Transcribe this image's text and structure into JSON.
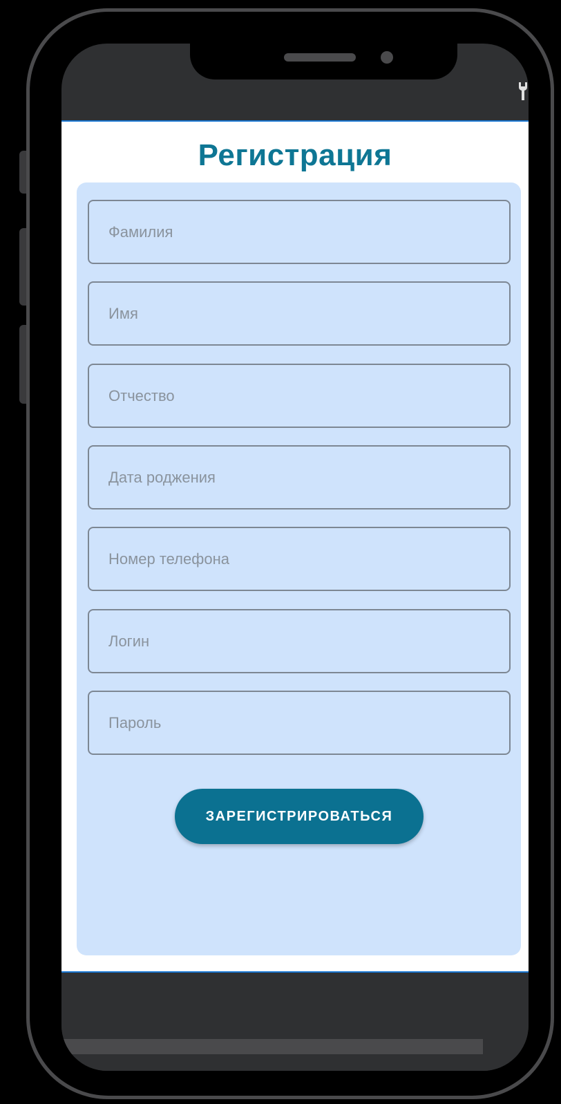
{
  "app": {
    "title": "Регистрация"
  },
  "form": {
    "fields": [
      {
        "name": "last-name",
        "placeholder": "Фамилия",
        "value": ""
      },
      {
        "name": "first-name",
        "placeholder": "Имя",
        "value": ""
      },
      {
        "name": "patronymic",
        "placeholder": "Отчество",
        "value": ""
      },
      {
        "name": "birth-date",
        "placeholder": "Дата роджения",
        "value": ""
      },
      {
        "name": "phone-number",
        "placeholder": "Номер телефона",
        "value": ""
      },
      {
        "name": "login",
        "placeholder": "Логин",
        "value": ""
      },
      {
        "name": "password",
        "placeholder": "Пароль",
        "value": ""
      }
    ],
    "submit_label": "ЗАРЕГИСТРИРОВАТЬСЯ"
  },
  "status_bar": {
    "icon": "wrench-icon"
  },
  "colors": {
    "accent": "#0b7191",
    "title": "#0e7694",
    "card_background": "#cfe3fc",
    "field_border": "#7d8793",
    "device_frame": "#4a4a4c",
    "system_bar": "#2f3032"
  }
}
